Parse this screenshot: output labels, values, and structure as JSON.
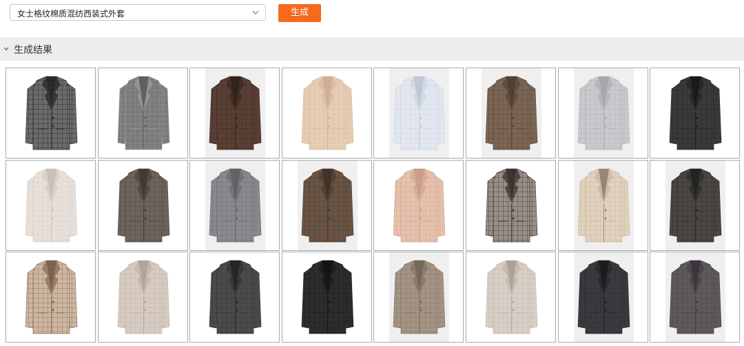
{
  "toolbar": {
    "prompt_value": "女士格纹棉质混纺西装式外套",
    "generate_label": "生成"
  },
  "results": {
    "section_title": "生成结果",
    "items": [
      {
        "bg": "white",
        "color": "#6b6b6b",
        "accent": "#2a2a2a",
        "lapel": "#1e1e1e"
      },
      {
        "bg": "white",
        "color": "#7a7a7a",
        "accent": "#9a9a9a",
        "lapel": "#5a5a5a"
      },
      {
        "bg": "grey",
        "color": "#5a4034",
        "accent": "#3c2a22",
        "lapel": "#2e2018"
      },
      {
        "bg": "white",
        "color": "#e6cdb5",
        "accent": "#d8bba0",
        "lapel": "#c9a98c"
      },
      {
        "bg": "grey",
        "color": "#e3e8f0",
        "accent": "#cdd4de",
        "lapel": "#b9c2cf"
      },
      {
        "bg": "grey",
        "color": "#7b6654",
        "accent": "#5c4a3c",
        "lapel": "#4a3a2e"
      },
      {
        "bg": "grey",
        "color": "#c9cacd",
        "accent": "#b0b2b6",
        "lapel": "#9fa1a6"
      },
      {
        "bg": "white",
        "color": "#3a3a3a",
        "accent": "#262626",
        "lapel": "#151515"
      },
      {
        "bg": "white",
        "color": "#e8e1db",
        "accent": "#d6cdc5",
        "lapel": "#c5bbb2"
      },
      {
        "bg": "white",
        "color": "#6c645d",
        "accent": "#4e4741",
        "lapel": "#3a342f"
      },
      {
        "bg": "grey",
        "color": "#8a8a8e",
        "accent": "#6e6e72",
        "lapel": "#5a5a5e"
      },
      {
        "bg": "grey",
        "color": "#6a5545",
        "accent": "#4e3e32",
        "lapel": "#3a2e25"
      },
      {
        "bg": "white",
        "color": "#e6c1ae",
        "accent": "#d4a992",
        "lapel": "#c49a84"
      },
      {
        "bg": "white",
        "color": "#9a8f87",
        "accent": "#3d3a38",
        "lapel": "#2a2725"
      },
      {
        "bg": "grey",
        "color": "#e0d2bd",
        "accent": "#c9b89f",
        "lapel": "#8a7a68"
      },
      {
        "bg": "grey",
        "color": "#4a4745",
        "accent": "#302e2c",
        "lapel": "#1f1d1c"
      },
      {
        "bg": "white",
        "color": "#cdb7a3",
        "accent": "#8e6f5a",
        "lapel": "#6e5544"
      },
      {
        "bg": "white",
        "color": "#d7ccc2",
        "accent": "#c2b5a9",
        "lapel": "#ab9d91"
      },
      {
        "bg": "white",
        "color": "#4b4b4e",
        "accent": "#333336",
        "lapel": "#202022"
      },
      {
        "bg": "white",
        "color": "#2d2d2f",
        "accent": "#1c1c1e",
        "lapel": "#111112"
      },
      {
        "bg": "grey",
        "color": "#a49484",
        "accent": "#86766a",
        "lapel": "#6e6054"
      },
      {
        "bg": "white",
        "color": "#d8cfc6",
        "accent": "#c2b7ad",
        "lapel": "#a89b90"
      },
      {
        "bg": "grey",
        "color": "#3c3a3e",
        "accent": "#2a282c",
        "lapel": "#18171a"
      },
      {
        "bg": "grey",
        "color": "#5f5b5c",
        "accent": "#47434a",
        "lapel": "#353136"
      }
    ]
  }
}
